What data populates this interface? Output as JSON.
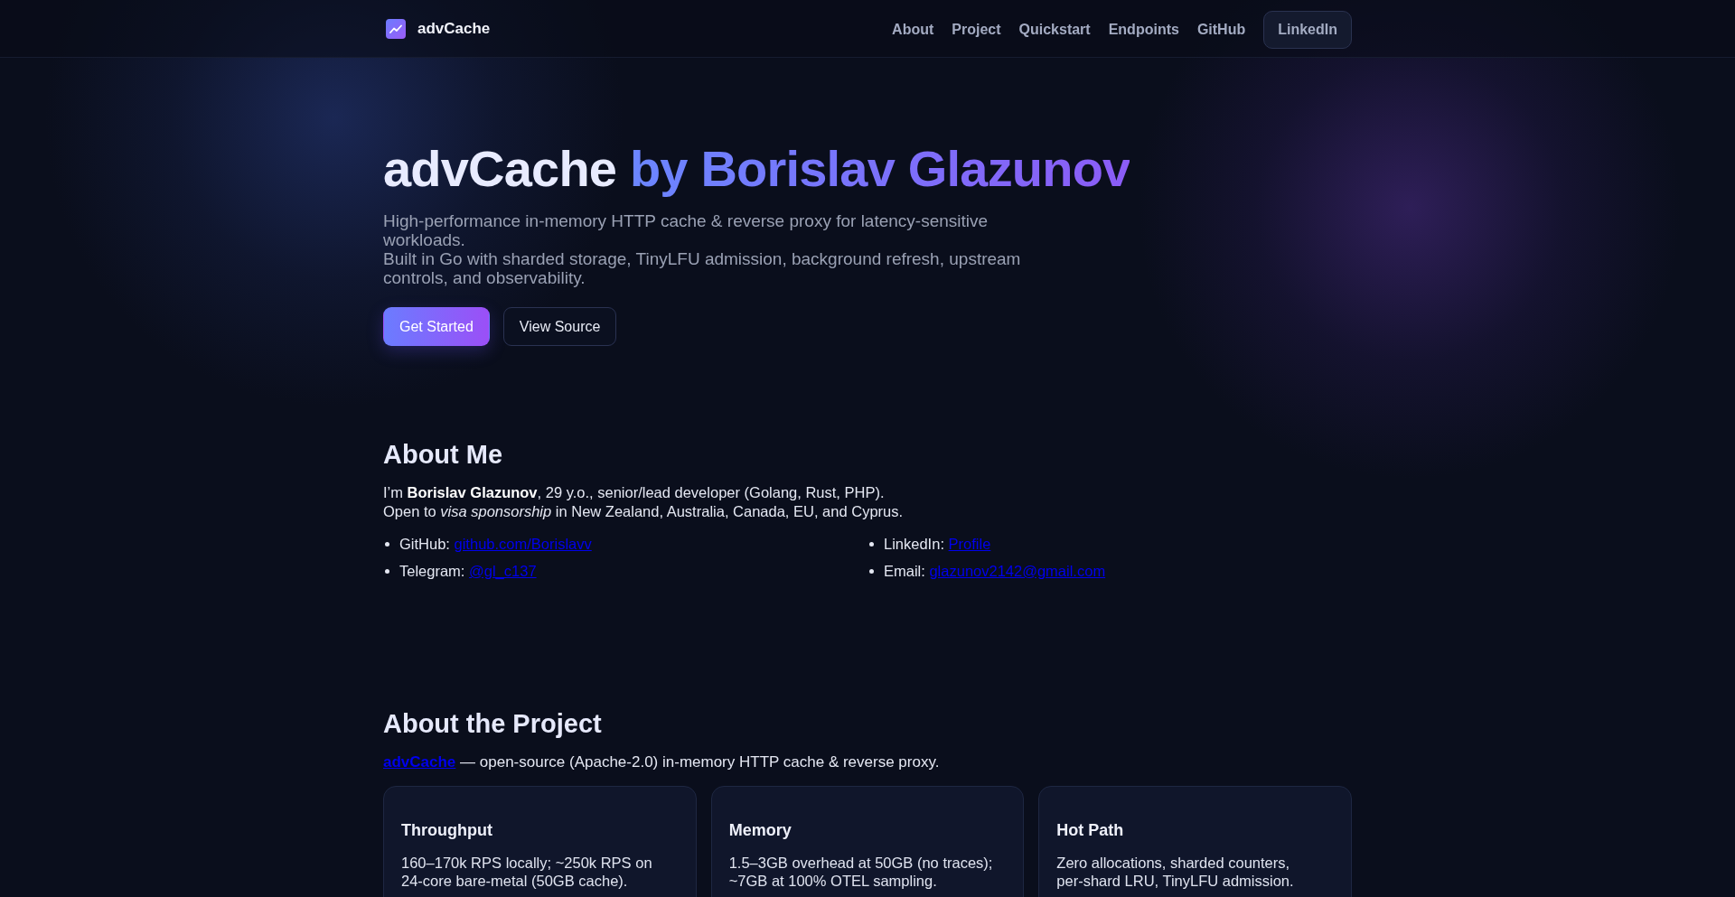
{
  "header": {
    "brand": "advCache",
    "nav": [
      {
        "label": "About",
        "kind": "link"
      },
      {
        "label": "Project",
        "kind": "link"
      },
      {
        "label": "Quickstart",
        "kind": "link"
      },
      {
        "label": "Endpoints",
        "kind": "link"
      },
      {
        "label": "GitHub",
        "kind": "link"
      },
      {
        "label": "LinkedIn",
        "kind": "button"
      }
    ]
  },
  "hero": {
    "title": "advCache",
    "title_accent": "by Borislav Glazunov",
    "lead_lines": [
      "High-performance in-memory HTTP cache & reverse proxy for latency-sensitive workloads.",
      "Built in Go with sharded storage, TinyLFU admission, background refresh, upstream controls, and observability."
    ],
    "buttons": [
      {
        "label": "Get Started",
        "kind": "primary"
      },
      {
        "label": "View Source",
        "kind": "secondary"
      }
    ]
  },
  "about_me": {
    "heading": "About Me",
    "intro_lines": [
      "I’m **Borislav Glazunov**, 29 y.o., senior/lead developer (Golang, Rust, PHP).",
      "Open to *visa sponsorship* in New Zealand, Australia, Canada, EU, and Cyprus."
    ],
    "contacts": [
      {
        "label": "GitHub:",
        "link": "github.com/Borislavv"
      },
      {
        "label": "LinkedIn:",
        "link": "Profile"
      },
      {
        "label": "Telegram:",
        "link": "@gl_c137"
      },
      {
        "label": "Email:",
        "link": "glazunov2142@gmail.com"
      }
    ]
  },
  "project": {
    "heading": "About the Project",
    "intro_link": "advCache",
    "intro_text": "— open-source (Apache-2.0) in-memory HTTP cache & reverse proxy.",
    "cards": [
      {
        "title": "Throughput",
        "text": "160–170k RPS locally; ~250k RPS on 24-core bare-metal (50GB cache)."
      },
      {
        "title": "Memory",
        "text": "1.5–3GB overhead at 50GB (no traces); ~7GB at 100% OTEL sampling."
      },
      {
        "title": "Hot Path",
        "text": "Zero allocations, sharded counters, per-shard LRU, TinyLFU admission."
      }
    ]
  }
}
